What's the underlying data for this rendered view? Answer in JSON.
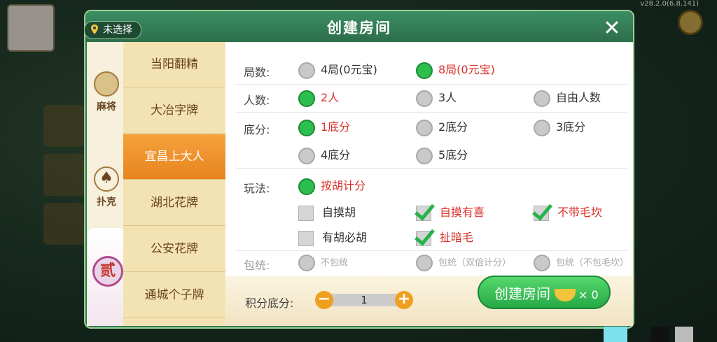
{
  "app": {
    "version": "v28.2.0(6.8.141)"
  },
  "dialog": {
    "title": "创建房间",
    "location_label": "未选择"
  },
  "categories": [
    {
      "label": "麻将"
    },
    {
      "label": "扑克"
    },
    {
      "label": "贰"
    }
  ],
  "games": [
    {
      "label": "当阳翻精",
      "active": false
    },
    {
      "label": "大冶字牌",
      "active": false
    },
    {
      "label": "宜昌上大人",
      "active": true
    },
    {
      "label": "湖北花牌",
      "active": false
    },
    {
      "label": "公安花牌",
      "active": false
    },
    {
      "label": "通城个子牌",
      "active": false
    }
  ],
  "options": {
    "rounds": {
      "label": "局数:",
      "choices": [
        {
          "label": "4局(0元宝)",
          "selected": false
        },
        {
          "label": "8局(0元宝)",
          "selected": true
        }
      ]
    },
    "players": {
      "label": "人数:",
      "choices": [
        {
          "label": "2人",
          "selected": true
        },
        {
          "label": "3人",
          "selected": false
        },
        {
          "label": "自由人数",
          "selected": false
        }
      ]
    },
    "base_score": {
      "label": "底分:",
      "choices": [
        {
          "label": "1底分",
          "selected": true
        },
        {
          "label": "2底分",
          "selected": false
        },
        {
          "label": "3底分",
          "selected": false
        },
        {
          "label": "4底分",
          "selected": false
        },
        {
          "label": "5底分",
          "selected": false
        }
      ]
    },
    "play_mode": {
      "label": "玩法:",
      "radio": {
        "label": "按胡计分",
        "selected": true
      },
      "checks": [
        {
          "label": "自摸胡",
          "checked": false
        },
        {
          "label": "自摸有喜",
          "checked": true
        },
        {
          "label": "不带毛坎",
          "checked": true
        },
        {
          "label": "有胡必胡",
          "checked": false
        },
        {
          "label": "扯暗毛",
          "checked": true
        }
      ]
    },
    "partial_row": {
      "label": "包统:",
      "choices": [
        "不包统",
        "包统（双倍计分）",
        "包统（不包毛坎）"
      ]
    }
  },
  "footer": {
    "score_label": "积分底分:",
    "score_value": "1",
    "minus": "−",
    "plus": "+",
    "create_label": "创建房间",
    "multiplier": "× 0"
  },
  "close_symbol": "✕",
  "colors": {
    "dialog_green": "#2f7a52",
    "selected_text": "#d8312a",
    "radio_on": "#2dbe4e",
    "tab_active": "#f6a13d",
    "create_button": "#26a845"
  }
}
